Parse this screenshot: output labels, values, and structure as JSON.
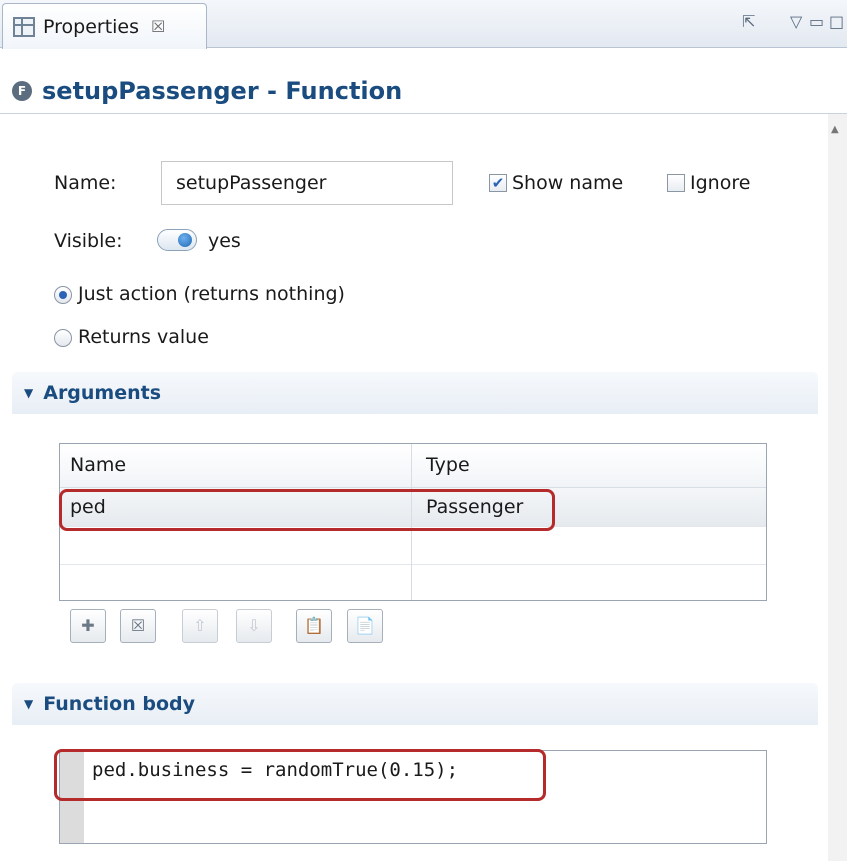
{
  "tab": {
    "label": "Properties",
    "close_glyph": "☒"
  },
  "toolbar": {
    "pin": "⇱",
    "menu": "▽",
    "minimize": "▭",
    "maximize": "□"
  },
  "header": {
    "badge": "F",
    "title": "setupPassenger - Function"
  },
  "form": {
    "name_label": "Name:",
    "name_value": "setupPassenger",
    "show_name_label": "Show name",
    "show_name_checked": true,
    "ignore_label": "Ignore",
    "ignore_checked": false,
    "visible_label": "Visible:",
    "visible_value": "yes",
    "radio_action_label": "Just action (returns nothing)",
    "radio_returns_label": "Returns value"
  },
  "arguments": {
    "section_label": "Arguments",
    "col_name": "Name",
    "col_type": "Type",
    "rows": [
      {
        "name": "ped",
        "type": "Passenger"
      },
      {
        "name": "",
        "type": ""
      },
      {
        "name": "",
        "type": ""
      }
    ],
    "buttons": {
      "add": "✚",
      "remove": "☒",
      "up": "⇧",
      "down": "⇩",
      "paste": "📋",
      "copy": "📄"
    }
  },
  "function_body": {
    "section_label": "Function body",
    "code": "ped.business = randomTrue(0.15);"
  },
  "colors": {
    "accent": "#1a4c80",
    "highlight": "#b52a2a",
    "selection": "#2b63b5"
  }
}
